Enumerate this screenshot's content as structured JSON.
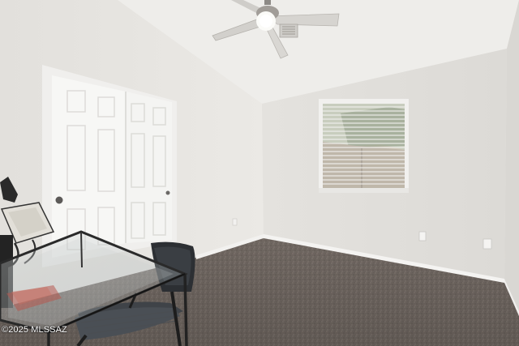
{
  "photo": {
    "watermark": "©2025 MLSSAZ",
    "colors": {
      "ceiling": "#eeedea",
      "left_wall": "#e6e4e0",
      "back_wall": "#e2e0dc",
      "right_wall": "#dddbd7",
      "carpet": "#756c66",
      "closet_door": "#f7f7f5",
      "window_view": "#cfc7b8"
    },
    "objects": [
      "ceiling-fan",
      "closet-door",
      "window-with-blinds",
      "glass-desk",
      "office-chair",
      "desk-lamp",
      "wall-outlet",
      "baseboard"
    ]
  }
}
